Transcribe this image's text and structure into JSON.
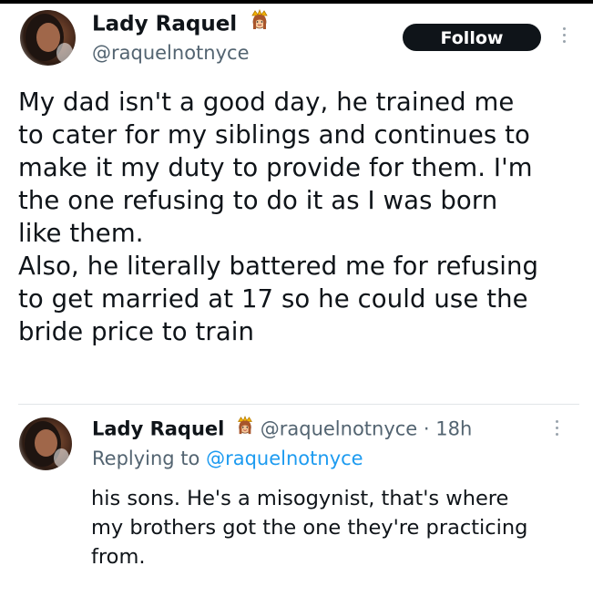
{
  "tweet": {
    "author_name": "Lady Raquel",
    "author_handle": "@raquelnotnyce",
    "follow_label": "Follow",
    "text_lines": [
      "My dad isn't a good day, he trained me",
      "to cater for my siblings and continues to",
      "make it my duty to provide for them. I'm",
      "the one refusing to do it as I was born",
      "like them.",
      "Also, he literally battered me for refusing",
      "to get married at 17 so he could use the",
      "bride price to train"
    ]
  },
  "reply": {
    "author_name": "Lady Raquel",
    "author_handle": "@raquelnotnyce",
    "separator": "·",
    "time": "18h",
    "replying_prefix": "Replying to",
    "replying_handle": "@raquelnotnyce",
    "text_lines": [
      "his sons. He's a misogynist, that's where",
      "my brothers got the one they're practicing",
      "from."
    ]
  },
  "icons": {
    "crown": "princess-emoji-icon",
    "more": "more-vertical-icon"
  }
}
